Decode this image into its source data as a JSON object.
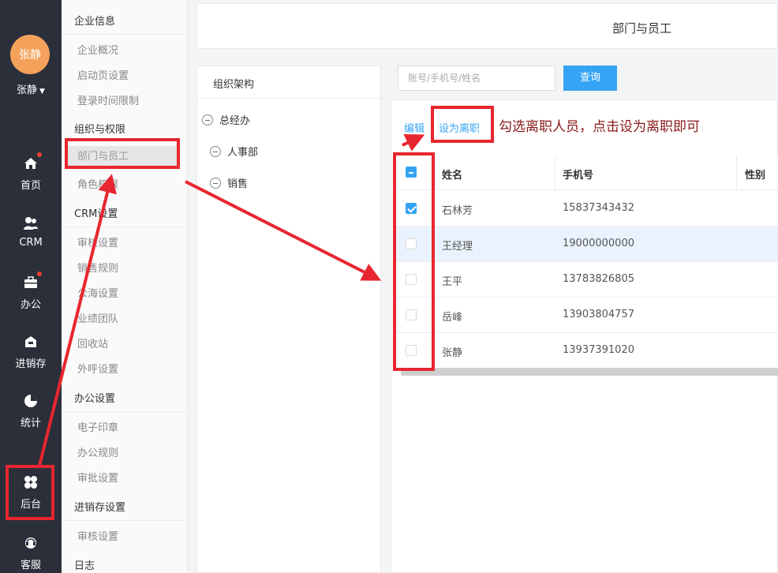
{
  "user": {
    "avatar_text": "张静",
    "name": "张静"
  },
  "nav": [
    {
      "label": "首页",
      "icon": "home-icon",
      "dot": true
    },
    {
      "label": "CRM",
      "icon": "crm-users-icon",
      "dot": false
    },
    {
      "label": "办公",
      "icon": "briefcase-icon",
      "dot": true
    },
    {
      "label": "进销存",
      "icon": "warehouse-icon",
      "dot": false
    },
    {
      "label": "统计",
      "icon": "pie-chart-icon",
      "dot": false
    },
    {
      "label": "后台",
      "icon": "grid-clover-icon",
      "dot": false
    },
    {
      "label": "客服",
      "icon": "headset-icon",
      "dot": false
    }
  ],
  "menu": {
    "sections": [
      {
        "title": "企业信息",
        "items": [
          "企业概况",
          "启动页设置",
          "登录时间限制"
        ]
      },
      {
        "title": "组织与权限",
        "items": [
          "部门与员工",
          "角色权限"
        ]
      },
      {
        "title": "CRM设置",
        "items": [
          "审核设置",
          "销售规则",
          "公海设置",
          "业绩团队",
          "回收站",
          "外呼设置"
        ]
      },
      {
        "title": "办公设置",
        "items": [
          "电子印章",
          "办公规则",
          "审批设置"
        ]
      },
      {
        "title": "进销存设置",
        "items": [
          "审核设置"
        ]
      },
      {
        "title": "日志",
        "items": []
      }
    ],
    "active_item": "部门与员工"
  },
  "header": {
    "title": "部门与员工"
  },
  "org": {
    "title": "组织架构",
    "tree": [
      {
        "label": "总经办",
        "level": 0
      },
      {
        "label": "人事部",
        "level": 1
      },
      {
        "label": "销售",
        "level": 1
      }
    ]
  },
  "search": {
    "placeholder": "账号/手机号/姓名",
    "button": "查询"
  },
  "actions": {
    "edit": "编辑",
    "set_resigned": "设为离职"
  },
  "annotation": "勾选离职人员，点击设为离职即可",
  "table": {
    "columns": [
      "姓名",
      "手机号",
      "性别"
    ],
    "rows": [
      {
        "name": "石林芳",
        "phone": "15837343432",
        "checked": true,
        "highlight": false
      },
      {
        "name": "王经理",
        "phone": "19000000000",
        "checked": false,
        "highlight": true
      },
      {
        "name": "王平",
        "phone": "13783826805",
        "checked": false,
        "highlight": false
      },
      {
        "name": "岳峰",
        "phone": "13903804757",
        "checked": false,
        "highlight": false
      },
      {
        "name": "张静",
        "phone": "13937391020",
        "checked": false,
        "highlight": false
      }
    ]
  },
  "colors": {
    "nav_bg": "#2b2f3a",
    "accent": "#35a4f4",
    "avatar": "#f4a25b",
    "annotation_red": "#e8262f",
    "badge": "#f04134"
  }
}
